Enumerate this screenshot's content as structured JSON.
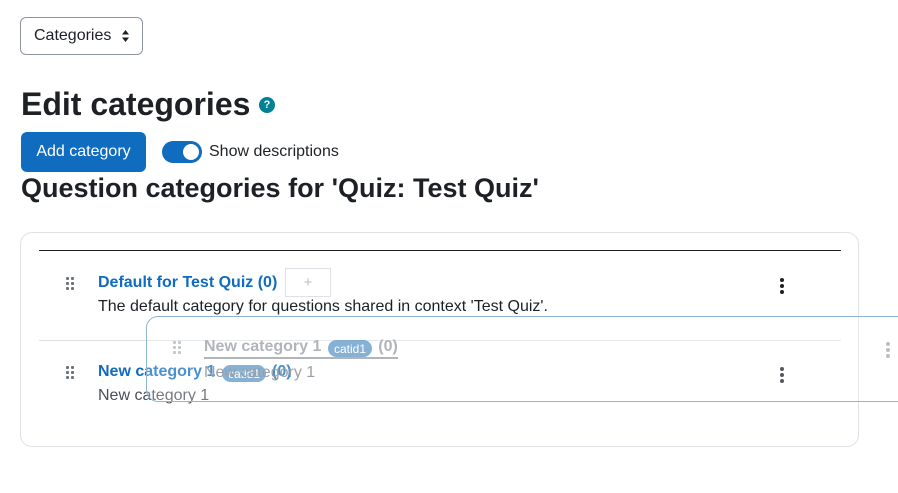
{
  "nav_select": {
    "value": "Categories"
  },
  "page_title": "Edit categories",
  "help_icon_glyph": "?",
  "add_category_label": "Add category",
  "show_descriptions_label": "Show descriptions",
  "show_descriptions_on": true,
  "section_title": "Question categories for 'Quiz: Test Quiz'",
  "categories": [
    {
      "name": "Default for Test Quiz",
      "count": "(0)",
      "description": "The default category for questions shared in context 'Test Quiz'.",
      "add_subcategory_glyph": "+"
    },
    {
      "name": "New category 1",
      "idnumber_badge": "catid1",
      "count": "(0)",
      "description": "New category 1"
    }
  ],
  "drag_ghost": {
    "name": "New category 1",
    "idnumber_badge": "catid1",
    "count": "(0)",
    "description": "New category 1"
  },
  "icons": {
    "nav_caret": "sort-caret-icon",
    "drag": "drag-handle-icon",
    "menu": "kebab-menu-icon",
    "help": "help-icon"
  },
  "colors": {
    "primary": "#0f6cbf",
    "help": "#008196",
    "badge": "#5e97c6"
  }
}
